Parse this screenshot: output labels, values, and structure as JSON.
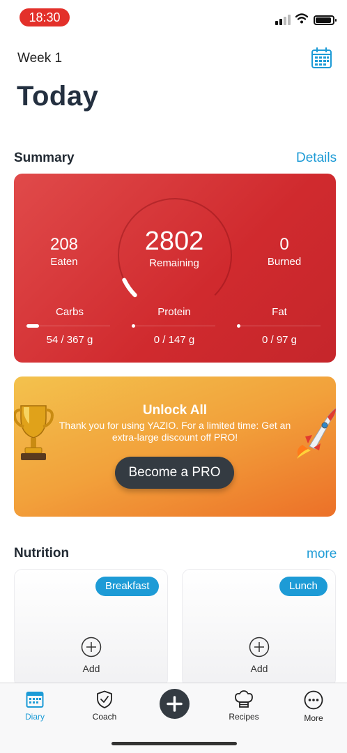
{
  "status_bar": {
    "time": "18:30"
  },
  "header": {
    "week": "Week 1",
    "title": "Today"
  },
  "summary": {
    "section_title": "Summary",
    "details_link": "Details",
    "eaten_value": "208",
    "eaten_label": "Eaten",
    "remaining_value": "2802",
    "remaining_label": "Remaining",
    "burned_value": "0",
    "burned_label": "Burned",
    "remaining_progress": 0.07,
    "macros": [
      {
        "label": "Carbs",
        "value": "54 / 367 g",
        "progress": 0.147
      },
      {
        "label": "Protein",
        "value": "0 / 147 g",
        "progress": 0
      },
      {
        "label": "Fat",
        "value": "0 / 97 g",
        "progress": 0
      }
    ]
  },
  "promo": {
    "title": "Unlock All",
    "text": "Thank you for using YAZIO. For a limited time: Get an extra-large discount off PRO!",
    "button": "Become a PRO"
  },
  "nutrition": {
    "section_title": "Nutrition",
    "more_link": "more",
    "meals": [
      {
        "badge": "Breakfast",
        "add_label": "Add"
      },
      {
        "badge": "Lunch",
        "add_label": "Add"
      }
    ]
  },
  "tab_bar": {
    "items": [
      {
        "label": "Diary",
        "icon": "calendar-icon",
        "active": true
      },
      {
        "label": "Coach",
        "icon": "shield-check-icon",
        "active": false
      },
      {
        "label": "Recipes",
        "icon": "chef-hat-icon",
        "active": false
      },
      {
        "label": "More",
        "icon": "more-dots-icon",
        "active": false
      }
    ],
    "fab_icon": "plus-icon"
  },
  "colors": {
    "accent": "#1d9bd6",
    "summary_card": "#d8323a",
    "promo_start": "#f3c24d",
    "promo_end": "#ec7028",
    "dark_button": "#343b42",
    "time_pill": "#e3302a"
  }
}
